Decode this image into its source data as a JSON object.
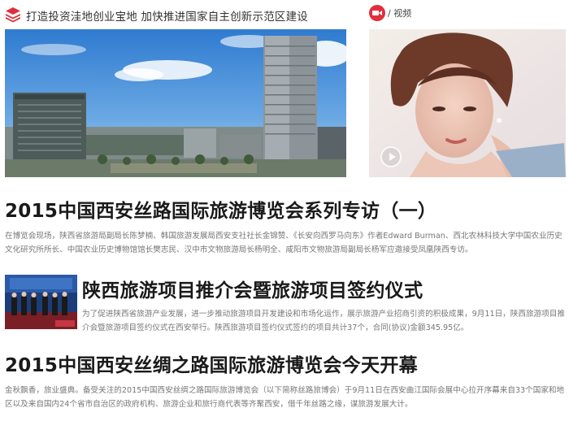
{
  "header": {
    "title": "打造投资洼地创业宝地 加快推进国家自主创新示范区建设",
    "icon": "stack-icon",
    "accent": "#e0303c"
  },
  "video": {
    "label": "/ 视频",
    "icon": "video-camera-icon",
    "play_icon": "play-icon"
  },
  "articles": [
    {
      "title": "2015中国西安丝路国际旅游博览会系列专访（一）",
      "summary": "在博览会现场，陕西省旅游局副局长陈梦楠、韩国旅游发展局西安支社社长金锦赞、《长安向西罗马向东》作者Edward Burman、西北农林科技大学中国农业历史文化研究所所长、中国农业历史博物馆馆长樊志民、汉中市文物旅游局长杨明全、咸阳市文物旅游局副局长杨军应邀接受凤凰陕西专访。"
    },
    {
      "title": "陕西旅游项目推介会暨旅游项目签约仪式",
      "summary": "为了促进陕西省旅游产业发展，进一步推动旅游项目开发建设和市场化运作，展示旅游产业招商引资的积极成果，9月11日，陕西旅游项目推介会暨旅游项目签约仪式在西安举行。陕西旅游项目签约仪式签约的项目共计37个，合同(协议)金额345.95亿。"
    },
    {
      "title": "2015中国西安丝绸之路国际旅游博览会今天开幕",
      "summary": "金秋飘香，旅业盛典。备受关注的2015中国西安丝绸之路国际旅游博览会（以下简称丝路旅博会）于9月11日在西安曲江国际会展中心拉开序幕来自33个国家和地区以及来自国内24个省市自治区的政府机构、旅游企业和旅行商代表等齐聚西安，借千年丝路之缘，谋旅游发展大计。"
    }
  ]
}
